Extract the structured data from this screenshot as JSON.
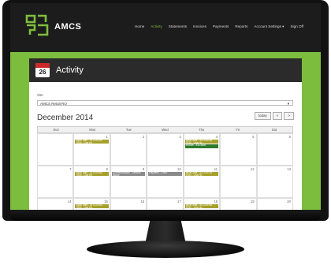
{
  "app": {
    "brand": "AMCS"
  },
  "nav": [
    "Home",
    "Activity",
    "Statements",
    "Invoices",
    "Payments",
    "Reports",
    "Account Settings ▾",
    "Sign Off"
  ],
  "nav_active": 1,
  "panel": {
    "title": "Activity",
    "icon_top": "JULY",
    "icon_num": "26"
  },
  "site": {
    "label": "Site",
    "value": "AMCS Retail RO"
  },
  "calendar": {
    "month": "December 2014",
    "today_label": "today",
    "prev_label": "<",
    "next_label": ">",
    "weekdays": [
      "Sun",
      "Mon",
      "Tue",
      "Wed",
      "Thu",
      "Fri",
      "Sat"
    ],
    "weeks": [
      [
        "",
        "1",
        "2",
        "3",
        "4",
        "5",
        "6"
      ],
      [
        "7",
        "8",
        "9",
        "10",
        "11",
        "12",
        "13"
      ],
      [
        "14",
        "15",
        "16",
        "17",
        "18",
        "19",
        "20"
      ]
    ],
    "events": [
      {
        "week": 0,
        "day": 1,
        "slot": 0,
        "text": "Issue date - 417234784 7834 - Lisa Ho",
        "color": "olive"
      },
      {
        "week": 0,
        "day": 4,
        "slot": 0,
        "text": "Issue date - 417234784 7834 - Lisa Ho",
        "color": "olive"
      },
      {
        "week": 0,
        "day": 4,
        "slot": 1,
        "text": "Invoice - 4423898",
        "color": "green"
      },
      {
        "week": 1,
        "day": 1,
        "slot": 0,
        "text": "Issue date - 417234784 7834 - Lisa Ho",
        "color": "olive"
      },
      {
        "week": 1,
        "day": 2,
        "slot": 0,
        "text": "Communication - Service Query",
        "color": "grey"
      },
      {
        "week": 1,
        "day": 3,
        "slot": 0,
        "text": "Payment - Card",
        "color": "grey"
      },
      {
        "week": 1,
        "day": 4,
        "slot": 0,
        "text": "Issue date - 417234784 7834 - Lisa Ho",
        "color": "olive"
      },
      {
        "week": 2,
        "day": 1,
        "slot": 0,
        "text": "Issue date - 417234784 7834 - Lisa Ho",
        "color": "olive"
      },
      {
        "week": 2,
        "day": 4,
        "slot": 0,
        "text": "Issue date - 417234784 7834 - Lisa Ho",
        "color": "olive"
      }
    ]
  },
  "colors": {
    "accent": "#7dbd3e",
    "appbar": "#1c1c1c",
    "event_olive": "#a6a02a",
    "event_green": "#2f7a2c",
    "event_grey": "#8a8a8a"
  }
}
